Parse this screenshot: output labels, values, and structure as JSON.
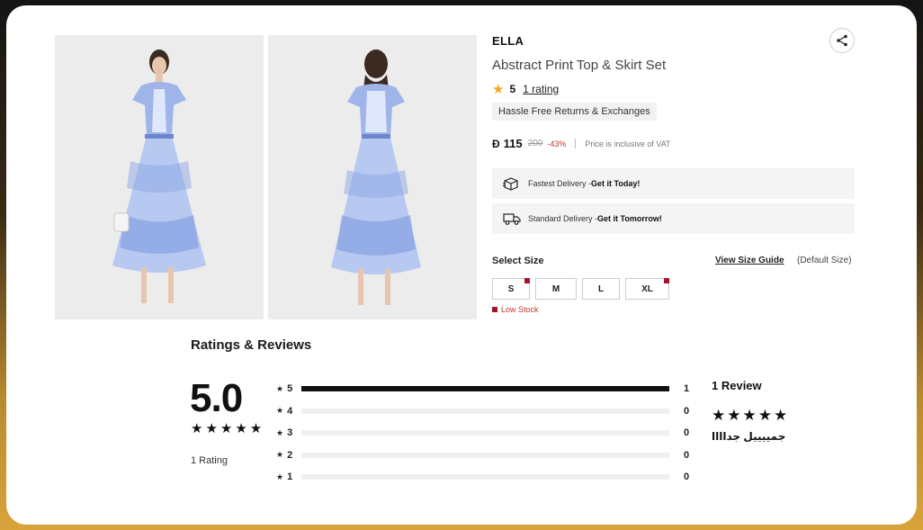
{
  "product": {
    "brand": "ELLA",
    "title": "Abstract Print Top & Skirt Set",
    "rating_value": "5",
    "rating_link": "1 rating",
    "badge": "Hassle Free Returns & Exchanges",
    "currency": "Đ",
    "price": "115",
    "old_price": "200",
    "discount": "-43%",
    "vat_note": "Price is inclusive of VAT"
  },
  "delivery": [
    {
      "label": "Fastest Delivery - ",
      "highlight": "Get it Today!",
      "icon": "box-fast-icon"
    },
    {
      "label": "Standard Delivery - ",
      "highlight": "Get it Tomorrow!",
      "icon": "truck-icon"
    }
  ],
  "size": {
    "heading": "Select Size",
    "guide_link": "View Size Guide",
    "default_note": "(Default Size)",
    "options": [
      {
        "label": "S",
        "low_stock": true
      },
      {
        "label": "M",
        "low_stock": false
      },
      {
        "label": "L",
        "low_stock": false
      },
      {
        "label": "XL",
        "low_stock": true
      }
    ],
    "low_stock_label": "Low Stock"
  },
  "reviews": {
    "title": "Ratings & Reviews",
    "score": "5.0",
    "stars": "★★★★★",
    "rating_count": "1 Rating",
    "breakdown": [
      {
        "star": "5",
        "count": "1",
        "fraction": 1
      },
      {
        "star": "4",
        "count": "0",
        "fraction": 0
      },
      {
        "star": "3",
        "count": "0",
        "fraction": 0
      },
      {
        "star": "2",
        "count": "0",
        "fraction": 0
      },
      {
        "star": "1",
        "count": "0",
        "fraction": 0
      }
    ],
    "review_count": "1 Review",
    "review_stars": "★★★★★",
    "review_text": "جمييييل جداااا"
  },
  "colors": {
    "accent_star": "#f5a623",
    "low_stock": "#a3162a",
    "discount": "#c0392b"
  }
}
